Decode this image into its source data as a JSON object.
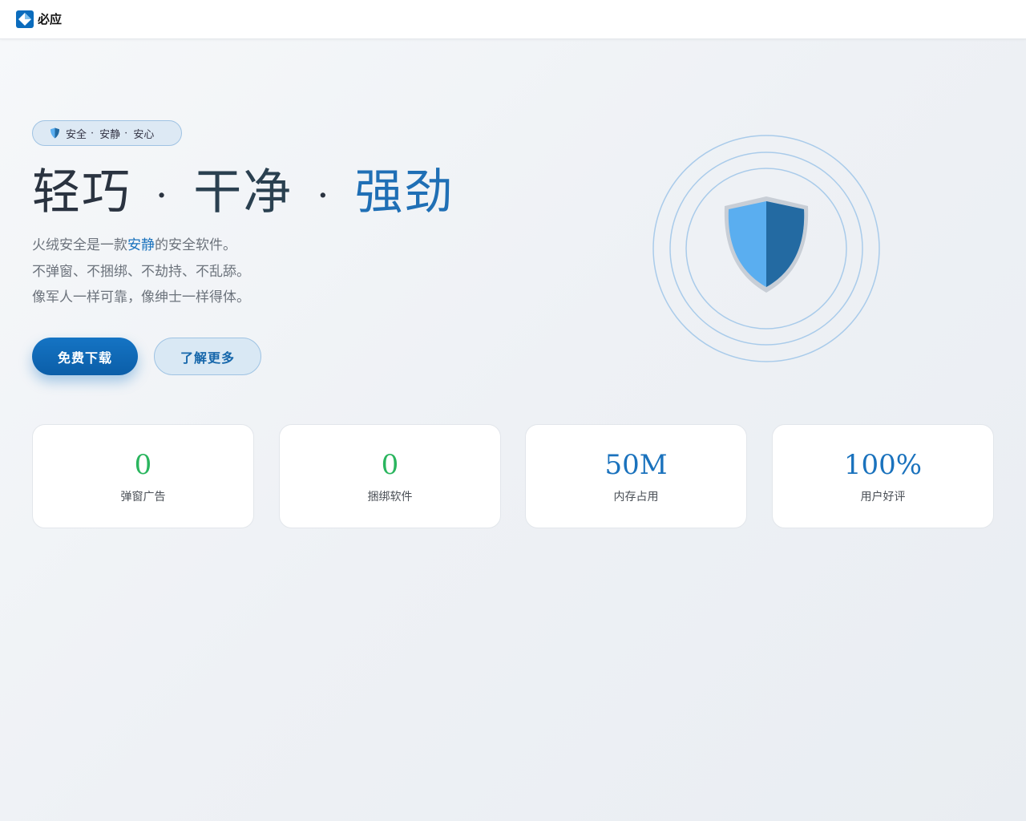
{
  "header": {
    "brand_name": "必应",
    "logo_icon": "bing-logo-icon"
  },
  "hero": {
    "tagline": {
      "icon": "shield-icon",
      "items": [
        "安全",
        "安静",
        "安心"
      ],
      "separator": "·"
    },
    "headline": {
      "part1": "轻巧",
      "part2": "干净",
      "part3": "强劲",
      "separator": "·"
    },
    "description": {
      "line1_before": "火绒安全是一款",
      "line1_highlight": "安静",
      "line1_after": "的安全软件。",
      "line2": "不弹窗、不捆绑、不劫持、不乱舔。",
      "line3": "像军人一样可靠，像绅士一样得体。"
    },
    "buttons": {
      "primary": "免费下载",
      "secondary": "了解更多"
    },
    "visual_icon": "shield-icon",
    "colors": {
      "accent": "#1574c4",
      "shield_light": "#5aaef0",
      "shield_dark": "#236aa2",
      "ring": "#a9cbea"
    }
  },
  "stats": [
    {
      "value": "0",
      "label": "弹窗广告",
      "color": "#2ab55e"
    },
    {
      "value": "0",
      "label": "捆绑软件",
      "color": "#2ab55e"
    },
    {
      "value": "50M",
      "label": "内存占用",
      "color": "#1a72bd"
    },
    {
      "value": "100%",
      "label": "用户好评",
      "color": "#1a72bd"
    }
  ]
}
